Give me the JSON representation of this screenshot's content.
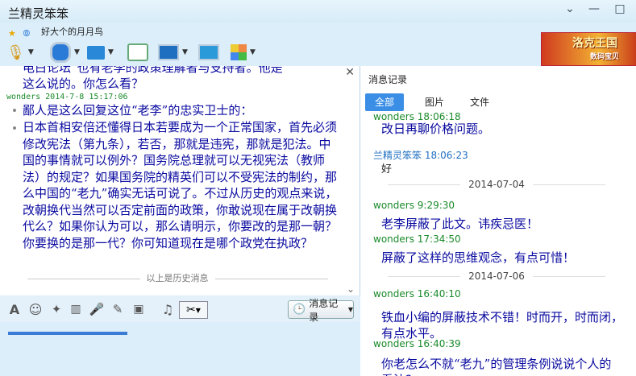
{
  "window": {
    "title": "兰精灵笨笨"
  },
  "status": {
    "signature": "好大个的月月鸟"
  },
  "banner": {
    "text": "洛克王国",
    "sub": "数码宝贝"
  },
  "chat": {
    "messages": [
      {
        "line": "电白论坛“也有老李的政策理解者与支持者。他是"
      },
      {
        "line": "这么说的。你怎么看？"
      }
    ],
    "sender": "wonders 2014-7-8 15:17:06",
    "reply": [
      "鄙人是这么回复这位“老李”的忠实卫士的：",
      "日本首相安倍还懂得日本若要成为一个正常国家，首先必须修改宪法（第九条），若否，那就是违宪，那就是犯法。中国的事情就可以例外？国务院总理就可以无视宪法（教师法）的规定？如果国务院的精英们可以不受宪法的制约，那么中国的“老九”确实无话可说了。不过从历史的观点来说，改朝换代当然可以否定前面的政策，你敢说现在属于改朝换代么？如果你认为可以，那么请明示，你要改的是那一朝？你要换的是那一代？你可知道现在是哪个政党在执政？"
    ],
    "history_label": "以上是历史消息"
  },
  "inputbar": {
    "record_label": "消息记录"
  },
  "right": {
    "header": "消息记录",
    "tabs": [
      "全部",
      "图片",
      "文件"
    ],
    "items": [
      {
        "kind": "sender",
        "cls": "g",
        "text": "wonders 18:06:18"
      },
      {
        "kind": "msg",
        "text": "改日再聊价格问题。"
      },
      {
        "kind": "sender",
        "cls": "b",
        "text": "兰精灵笨笨 18:06:23"
      },
      {
        "kind": "plain",
        "text": "好"
      },
      {
        "kind": "date",
        "text": "2014-07-04"
      },
      {
        "kind": "sender",
        "cls": "g",
        "text": "wonders 9:29:30"
      },
      {
        "kind": "msg",
        "text": "老李屏蔽了此文。讳疾忌医！"
      },
      {
        "kind": "sender",
        "cls": "g",
        "text": "wonders 17:34:50"
      },
      {
        "kind": "msg",
        "text": "屏蔽了这样的思维观念，有点可惜！"
      },
      {
        "kind": "date",
        "text": "2014-07-06"
      },
      {
        "kind": "sender",
        "cls": "g",
        "text": "wonders 16:40:10"
      },
      {
        "kind": "msg",
        "text": "铁血小编的屏蔽技术不错！时而开，时而闭，有点水平。"
      },
      {
        "kind": "sender",
        "cls": "g",
        "text": "wonders 16:40:39"
      },
      {
        "kind": "msg",
        "text": "你老怎么不就“老九”的管理条例说说个人的看法？"
      }
    ]
  }
}
